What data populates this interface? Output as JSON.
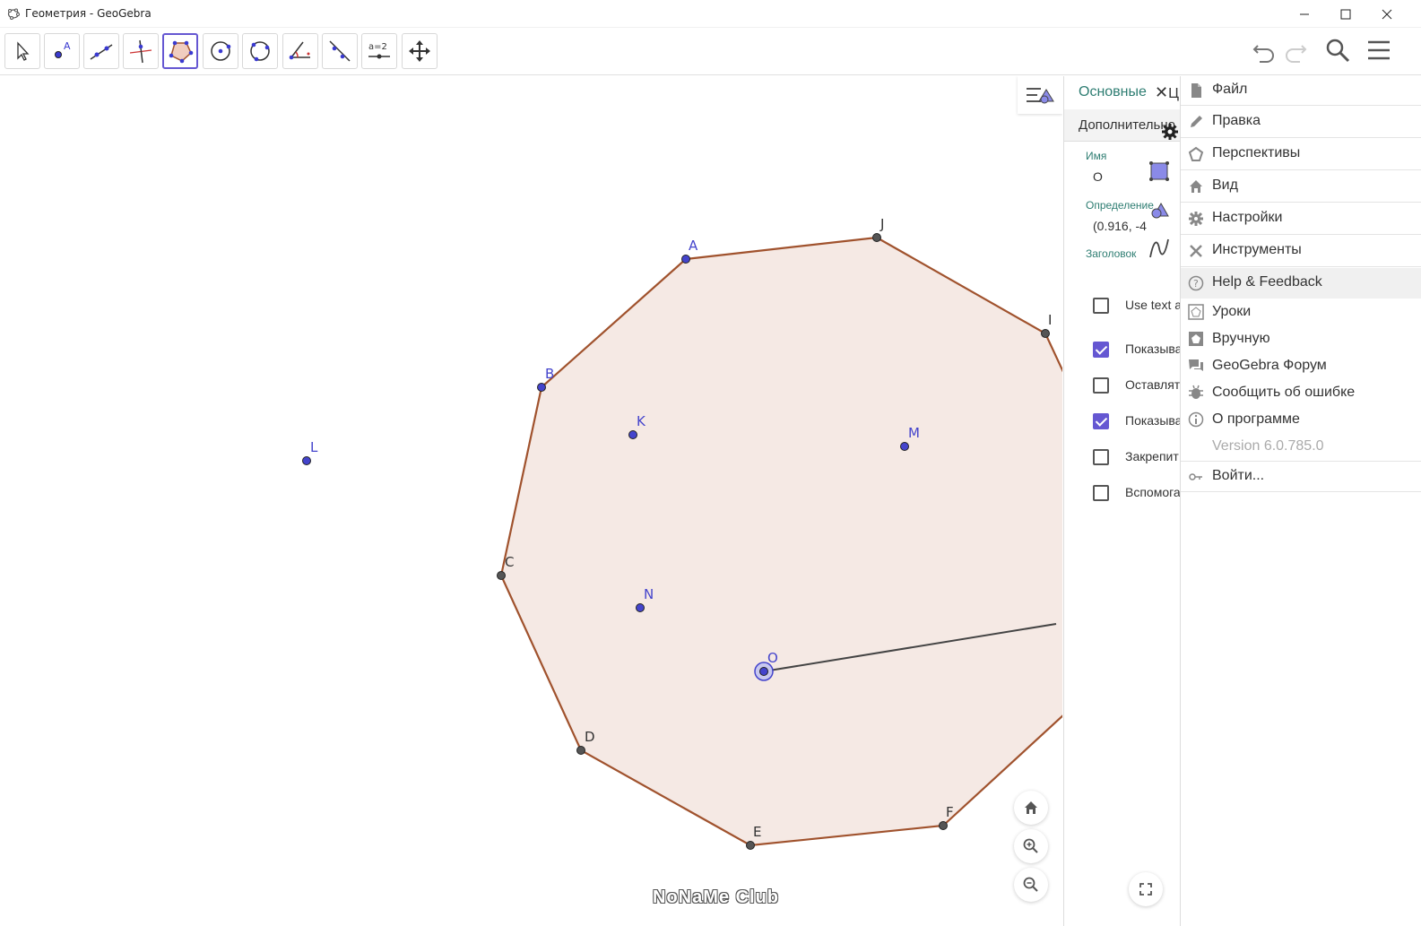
{
  "window": {
    "title": "Геометрия - GeoGebra"
  },
  "toolbar": {
    "tools": [
      {
        "name": "move-tool",
        "icon": "arrow-icon"
      },
      {
        "name": "point-tool",
        "icon": "point-icon"
      },
      {
        "name": "line-tool",
        "icon": "line-icon"
      },
      {
        "name": "perpendicular-tool",
        "icon": "perpendicular-icon"
      },
      {
        "name": "polygon-tool",
        "icon": "polygon-icon",
        "active": true
      },
      {
        "name": "circle-center-tool",
        "icon": "circle-center-icon"
      },
      {
        "name": "circle-three-points-tool",
        "icon": "circle-three-points-icon"
      },
      {
        "name": "angle-tool",
        "icon": "angle-icon"
      },
      {
        "name": "reflect-tool",
        "icon": "reflect-icon"
      },
      {
        "name": "slider-tool",
        "icon": "slider-icon",
        "label": "a=2"
      },
      {
        "name": "move-graphics-tool",
        "icon": "move-graphics-icon"
      }
    ]
  },
  "geometry": {
    "polygon_color": "#a0522d",
    "fill_color": "#f5e9e4",
    "point_color": "#4444cc",
    "vertex_color": "#444444",
    "free_points": [
      {
        "label": "A"
      },
      {
        "label": "B"
      },
      {
        "label": "K"
      },
      {
        "label": "M"
      },
      {
        "label": "L"
      },
      {
        "label": "N"
      },
      {
        "label": "O"
      }
    ],
    "vertices": [
      {
        "label": "J"
      },
      {
        "label": "I"
      },
      {
        "label": "C"
      },
      {
        "label": "D"
      },
      {
        "label": "E"
      },
      {
        "label": "F"
      }
    ]
  },
  "properties": {
    "tab_main": "Основные",
    "tab_next": "Ц",
    "subtab": "Дополнительно",
    "name_label": "Имя",
    "name_value": "O",
    "definition_label": "Определение",
    "definition_value": "(0.916, -4",
    "caption_label": "Заголовок",
    "checkboxes": [
      {
        "label": "Use text a",
        "checked": false
      },
      {
        "label": "Показыва",
        "checked": true
      },
      {
        "label": "Оставлят",
        "checked": false
      },
      {
        "label": "Показыва",
        "checked": true
      },
      {
        "label": "Закрепит",
        "checked": false
      },
      {
        "label": "Вспомога",
        "checked": false
      }
    ]
  },
  "menu": {
    "items": [
      {
        "label": "Файл",
        "icon": "file-icon"
      },
      {
        "label": "Правка",
        "icon": "pencil-icon"
      },
      {
        "label": "Перспективы",
        "icon": "perspectives-icon"
      },
      {
        "label": "Вид",
        "icon": "home-icon"
      },
      {
        "label": "Настройки",
        "icon": "gear-icon"
      },
      {
        "label": "Инструменты",
        "icon": "tools-icon"
      },
      {
        "label": "Help & Feedback",
        "icon": "help-icon"
      },
      {
        "label": "Уроки",
        "icon": "tutorials-icon"
      },
      {
        "label": "Вручную",
        "icon": "manual-icon"
      },
      {
        "label": "GeoGebra Форум",
        "icon": "forum-icon"
      },
      {
        "label": "Сообщить об ошибке",
        "icon": "bug-icon"
      },
      {
        "label": "О программе",
        "icon": "info-icon"
      },
      {
        "label": "Version 6.0.785.0",
        "icon": ""
      },
      {
        "label": "Войти...",
        "icon": "sign-in-icon"
      }
    ]
  },
  "watermark": "NoNaMe Club"
}
